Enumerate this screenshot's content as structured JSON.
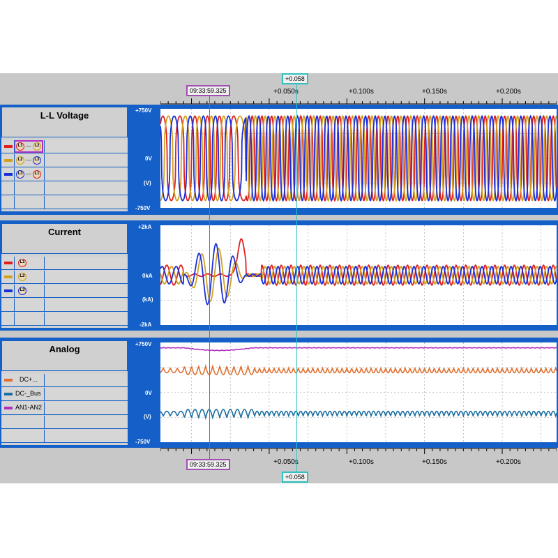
{
  "top_axis": {
    "ticks": [
      "+0.050s",
      "+0.100s",
      "+0.150s",
      "+0.200s"
    ]
  },
  "bottom_axis": {
    "ticks": [
      "+0.050s",
      "+0.100s",
      "+0.150s",
      "+0.200s"
    ]
  },
  "markers": {
    "time_cursor": "09:33:59.325",
    "delta_cursor": "+0.058",
    "time_cursor_color": "#a050b0",
    "delta_cursor_color": "#30c0c0"
  },
  "panels": [
    {
      "title": "L-L Voltage",
      "y_top": "+750V",
      "y_mid": "0V",
      "y_unit": "(V)",
      "y_bottom": "-750V",
      "legend": [
        {
          "color": "#e02020",
          "a": "L1",
          "b": "L2",
          "a_color": "#e02020",
          "b_color": "#d0a020"
        },
        {
          "color": "#d0a020",
          "a": "L2",
          "b": "L3",
          "a_color": "#d0a020",
          "b_color": "#1a2ed8"
        },
        {
          "color": "#1a2ed8",
          "a": "L3",
          "b": "L1",
          "a_color": "#1a2ed8",
          "b_color": "#e02020"
        }
      ]
    },
    {
      "title": "Current",
      "y_top": "+2kA",
      "y_mid": "0kA",
      "y_unit": "(kA)",
      "y_bottom": "-2kA",
      "legend": [
        {
          "color": "#e02020",
          "a": "L1",
          "a_color": "#e02020"
        },
        {
          "color": "#d0a020",
          "a": "L2",
          "a_color": "#d0a020"
        },
        {
          "color": "#1a2ed8",
          "a": "L3",
          "a_color": "#1a2ed8"
        }
      ]
    },
    {
      "title": "Analog",
      "y_top": "+750V",
      "y_mid": "0V",
      "y_unit": "(V)",
      "y_bottom": "-750V",
      "legend": [
        {
          "color": "#e07030",
          "label": "DC+..."
        },
        {
          "color": "#1a6ea0",
          "label": "DC-_Bus"
        },
        {
          "color": "#b030c0",
          "label": "AN1-AN2"
        }
      ]
    }
  ],
  "chart_data": [
    {
      "type": "line",
      "title": "L-L Voltage",
      "xlabel": "",
      "ylabel": "(V)",
      "x_range": [
        -0.02,
        0.235
      ],
      "ylim": [
        -750,
        750
      ],
      "series": [
        {
          "name": "L1 — L2",
          "color": "#e02020",
          "amplitude": 640,
          "frequency_hz": 160
        },
        {
          "name": "L2 — L3",
          "color": "#d0a020",
          "amplitude": 640,
          "frequency_hz": 160
        },
        {
          "name": "L3 — L1",
          "color": "#1a2ed8",
          "amplitude": 640,
          "frequency_hz": 160
        }
      ]
    },
    {
      "type": "line",
      "title": "Current",
      "xlabel": "",
      "ylabel": "(kA)",
      "x_range": [
        -0.02,
        0.235
      ],
      "ylim": [
        -2,
        2
      ],
      "series": [
        {
          "name": "L1",
          "color": "#e02020",
          "amplitude": 0.4,
          "peak": 1.5
        },
        {
          "name": "L2",
          "color": "#d0a020",
          "amplitude": 0.35,
          "peak": 1.2
        },
        {
          "name": "L3",
          "color": "#1a2ed8",
          "amplitude": 0.35,
          "peak": -1.4
        }
      ]
    },
    {
      "type": "line",
      "title": "Analog",
      "xlabel": "",
      "ylabel": "(V)",
      "x_range": [
        -0.02,
        0.235
      ],
      "ylim": [
        -750,
        750
      ],
      "series": [
        {
          "name": "DC+...",
          "color": "#e07030",
          "mean": 330,
          "ripple": 80
        },
        {
          "name": "DC-_Bus",
          "color": "#1a6ea0",
          "mean": -320,
          "ripple": 80
        },
        {
          "name": "AN1-AN2",
          "color": "#b030c0",
          "mean": 670,
          "ripple": 10
        }
      ]
    }
  ]
}
